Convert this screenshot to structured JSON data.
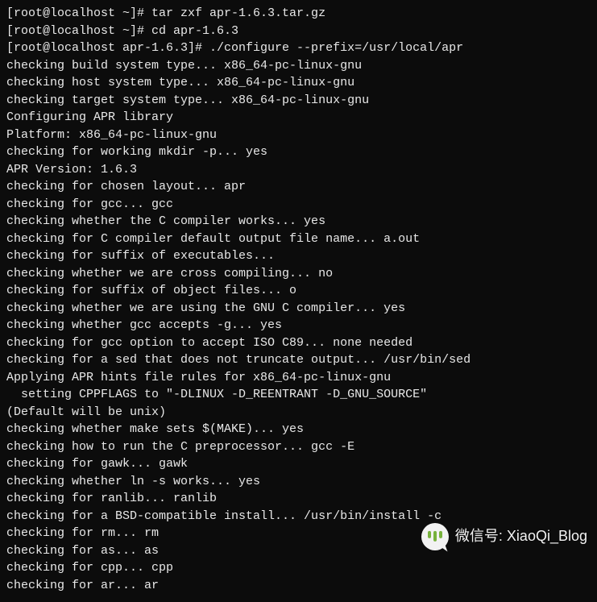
{
  "terminal": {
    "lines": [
      "[root@localhost ~]# tar zxf apr-1.6.3.tar.gz",
      "[root@localhost ~]# cd apr-1.6.3",
      "[root@localhost apr-1.6.3]# ./configure --prefix=/usr/local/apr",
      "checking build system type... x86_64-pc-linux-gnu",
      "checking host system type... x86_64-pc-linux-gnu",
      "checking target system type... x86_64-pc-linux-gnu",
      "Configuring APR library",
      "Platform: x86_64-pc-linux-gnu",
      "checking for working mkdir -p... yes",
      "APR Version: 1.6.3",
      "checking for chosen layout... apr",
      "checking for gcc... gcc",
      "checking whether the C compiler works... yes",
      "checking for C compiler default output file name... a.out",
      "checking for suffix of executables...",
      "checking whether we are cross compiling... no",
      "checking for suffix of object files... o",
      "checking whether we are using the GNU C compiler... yes",
      "checking whether gcc accepts -g... yes",
      "checking for gcc option to accept ISO C89... none needed",
      "checking for a sed that does not truncate output... /usr/bin/sed",
      "Applying APR hints file rules for x86_64-pc-linux-gnu",
      "  setting CPPFLAGS to \"-DLINUX -D_REENTRANT -D_GNU_SOURCE\"",
      "(Default will be unix)",
      "checking whether make sets $(MAKE)... yes",
      "checking how to run the C preprocessor... gcc -E",
      "checking for gawk... gawk",
      "checking whether ln -s works... yes",
      "checking for ranlib... ranlib",
      "checking for a BSD-compatible install... /usr/bin/install -c",
      "checking for rm... rm",
      "checking for as... as",
      "checking for cpp... cpp",
      "checking for ar... ar"
    ]
  },
  "watermark": {
    "label": "微信号",
    "value": "XiaoQi_Blog"
  }
}
